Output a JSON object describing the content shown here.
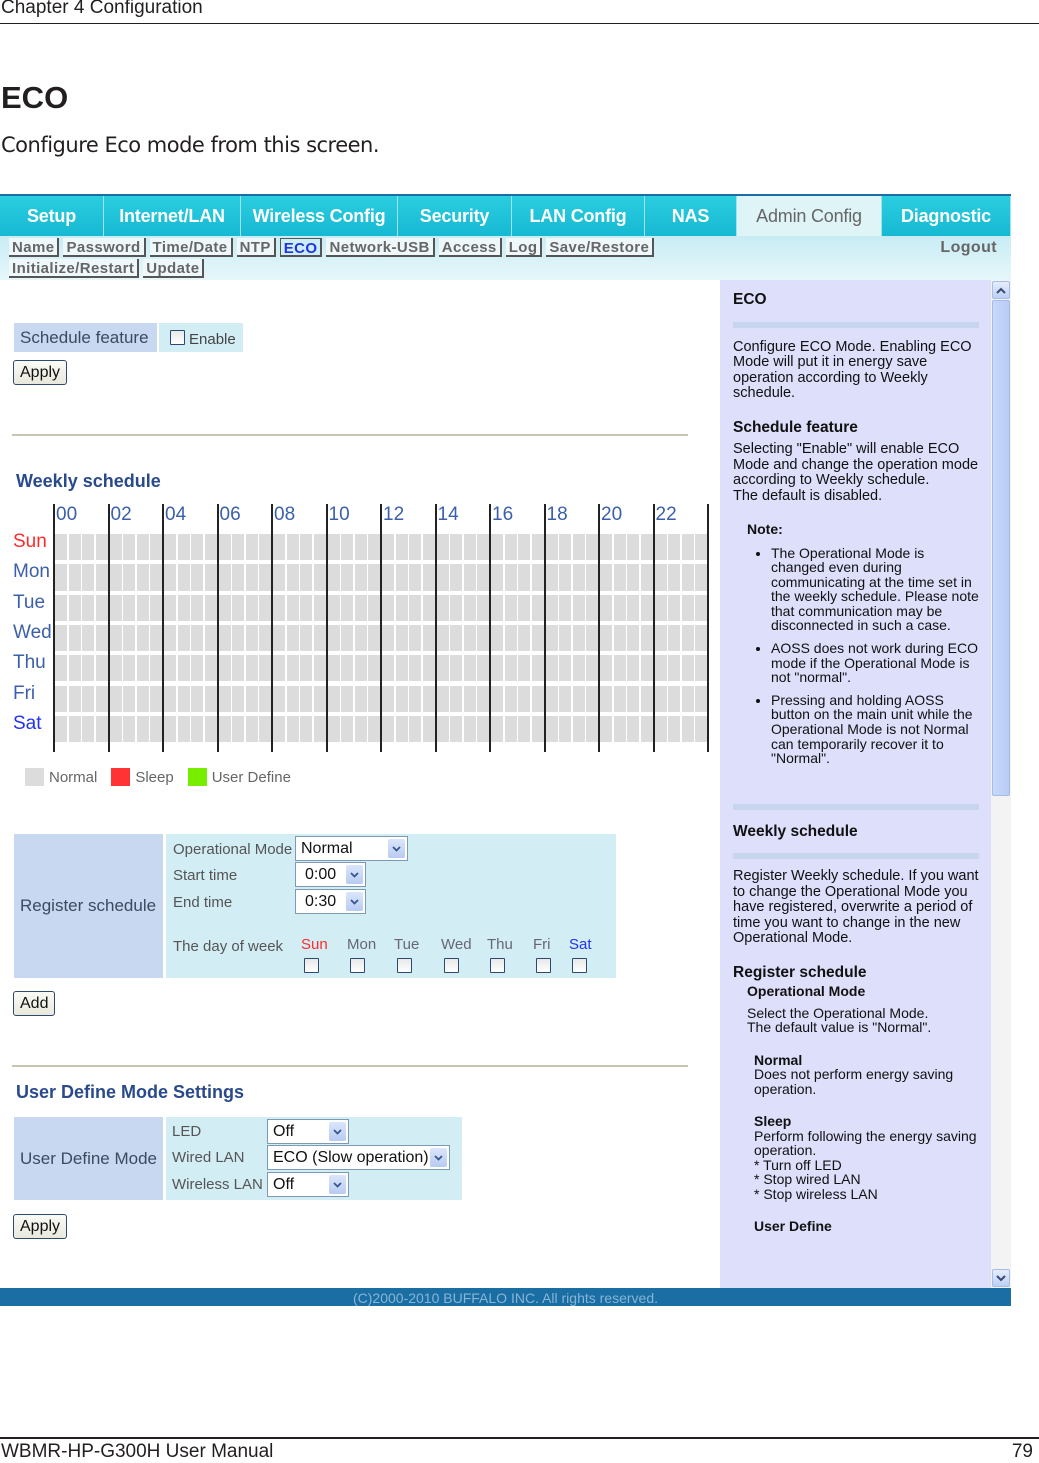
{
  "page_header": {
    "chapter": "Chapter 4  Configuration"
  },
  "doc": {
    "title": "ECO",
    "subtitle": "Configure Eco mode from this screen."
  },
  "tabs": [
    {
      "label": "Setup",
      "active": false
    },
    {
      "label": "Internet/LAN",
      "active": false
    },
    {
      "label": "Wireless Config",
      "active": false
    },
    {
      "label": "Security",
      "active": false
    },
    {
      "label": "LAN Config",
      "active": false
    },
    {
      "label": "NAS",
      "active": false
    },
    {
      "label": "Admin Config",
      "active": true
    },
    {
      "label": "Diagnostic",
      "active": false
    }
  ],
  "subnav": {
    "row1": [
      "Name",
      "Password",
      "Time/Date",
      "NTP",
      "ECO",
      "Network-USB",
      "Access",
      "Log",
      "Save/Restore"
    ],
    "row2": [
      "Initialize/Restart",
      "Update"
    ],
    "active": "ECO",
    "logout": "Logout"
  },
  "schedule_feature": {
    "label": "Schedule feature",
    "checkbox_label": "Enable",
    "checked": false,
    "apply": "Apply"
  },
  "weekly": {
    "title": "Weekly schedule",
    "hours": [
      "00",
      "02",
      "04",
      "06",
      "08",
      "10",
      "12",
      "14",
      "16",
      "18",
      "20",
      "22"
    ],
    "days": [
      {
        "label": "Sun",
        "color": "#ff2a2a"
      },
      {
        "label": "Mon",
        "color": "#3b5fa8"
      },
      {
        "label": "Tue",
        "color": "#3b5fa8"
      },
      {
        "label": "Wed",
        "color": "#3b5fa8"
      },
      {
        "label": "Thu",
        "color": "#3b5fa8"
      },
      {
        "label": "Fri",
        "color": "#3b5fa8"
      },
      {
        "label": "Sat",
        "color": "#2233ee"
      }
    ],
    "slots_per_day": 48,
    "slot_mode_all": "Normal",
    "legend": [
      {
        "label": "Normal",
        "color": "#dcdcdc"
      },
      {
        "label": "Sleep",
        "color": "#ff3333"
      },
      {
        "label": "User Define",
        "color": "#77ee00"
      }
    ]
  },
  "register": {
    "label": "Register schedule",
    "op_mode_label": "Operational Mode",
    "op_mode_value": "Normal",
    "start_label": "Start time",
    "start_value": "0:00",
    "end_label": "End time",
    "end_value": "0:30",
    "dow_label": "The day of week",
    "days": [
      {
        "label": "Sun",
        "color": "#ff2a2a",
        "checked": false
      },
      {
        "label": "Mon",
        "color": "#667",
        "checked": false
      },
      {
        "label": "Tue",
        "color": "#667",
        "checked": false
      },
      {
        "label": "Wed",
        "color": "#667",
        "checked": false
      },
      {
        "label": "Thu",
        "color": "#667",
        "checked": false
      },
      {
        "label": "Fri",
        "color": "#667",
        "checked": false
      },
      {
        "label": "Sat",
        "color": "#2233ee",
        "checked": false
      }
    ],
    "add": "Add"
  },
  "user_define": {
    "title": "User Define Mode Settings",
    "label": "User Define Mode",
    "led_label": "LED",
    "led_value": "Off",
    "wired_label": "Wired LAN",
    "wired_value": "ECO (Slow operation)",
    "wireless_label": "Wireless LAN",
    "wireless_value": "Off",
    "apply": "Apply"
  },
  "help": {
    "eco_title": "ECO",
    "eco_text": "Configure ECO Mode. Enabling ECO Mode will put it in energy save operation according to Weekly schedule.",
    "sf_title": "Schedule feature",
    "sf_text": "Selecting \"Enable\" will enable ECO Mode and change the operation mode according to Weekly schedule.",
    "sf_default": "The default is disabled.",
    "note_title": "Note:",
    "notes": [
      "The Operational Mode is changed even during communicating at the time set in the weekly schedule. Please note that communication may be disconnected in such a case.",
      "AOSS does not work during ECO mode if the Operational Mode is not \"normal\".",
      "Pressing and holding AOSS button on the main unit while the Operational Mode is not Normal can temporarily recover it to \"Normal\"."
    ],
    "ws_title": "Weekly schedule",
    "ws_text": "Register Weekly schedule. If you want to change the Operational Mode you have registered, overwrite a period of time you want to change in the new Operational Mode.",
    "rs_title": "Register schedule",
    "om_title": "Operational Mode",
    "om_text1": "Select the Operational Mode.",
    "om_text2": "The default value is \"Normal\".",
    "normal_title": "Normal",
    "normal_text": "Does not perform energy saving operation.",
    "sleep_title": "Sleep",
    "sleep_text": "Perform following the energy saving operation.",
    "sleep_items": [
      "* Turn off LED",
      "* Stop wired LAN",
      "* Stop wireless LAN"
    ],
    "ud_title": "User Define"
  },
  "copyright": "(C)2000-2010 BUFFALO INC. All rights reserved.",
  "page_footer": {
    "manual": "WBMR-HP-G300H User Manual",
    "page": "79"
  }
}
